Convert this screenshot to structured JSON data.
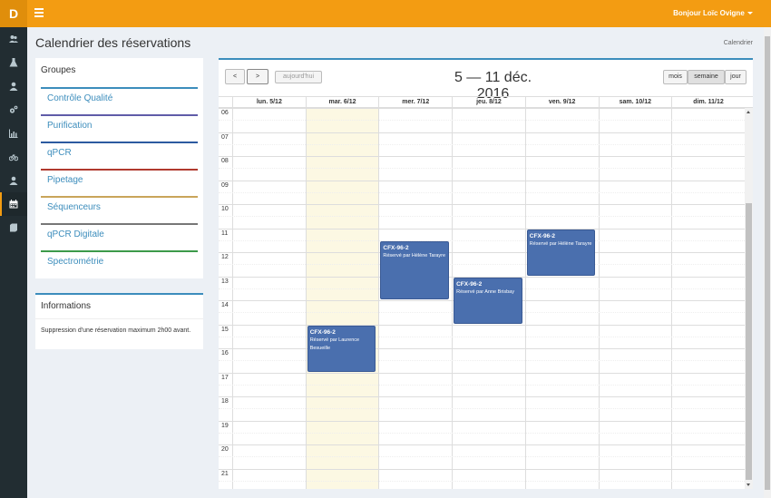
{
  "app": {
    "logo": "D"
  },
  "header": {
    "user_menu": "Bonjour Loïc Ovigne"
  },
  "sidebar": {
    "items": [
      {
        "name": "users-icon",
        "active": false
      },
      {
        "name": "flask-icon",
        "active": false
      },
      {
        "name": "user-icon",
        "active": false
      },
      {
        "name": "gears-icon",
        "active": false
      },
      {
        "name": "chart-icon",
        "active": false
      },
      {
        "name": "bicycle-icon",
        "active": false
      },
      {
        "name": "user-icon",
        "active": false
      },
      {
        "name": "calendar-icon",
        "active": true
      },
      {
        "name": "book-icon",
        "active": false
      }
    ]
  },
  "page": {
    "title": "Calendrier des réservations",
    "breadcrumb": "Calendrier"
  },
  "groups": {
    "title": "Groupes",
    "items": [
      {
        "label": "Contrôle Qualité",
        "color": "#3c8dbc"
      },
      {
        "label": "Purification",
        "color": "#605ca8"
      },
      {
        "label": "qPCR",
        "color": "#2c5aa0"
      },
      {
        "label": "Pipetage",
        "color": "#b03a2e"
      },
      {
        "label": "Séquenceurs",
        "color": "#c9a55a"
      },
      {
        "label": "qPCR Digitale",
        "color": "#777777"
      },
      {
        "label": "Spectrométrie",
        "color": "#3c9a4a"
      }
    ]
  },
  "info": {
    "title": "Informations",
    "text": "Suppression d'une réservation maximum 2h00 avant."
  },
  "calendar": {
    "prev_label": "<",
    "next_label": ">",
    "today_label": "aujourd'hui",
    "title": "5 — 11 déc. 2016",
    "views": [
      {
        "label": "mois",
        "active": false
      },
      {
        "label": "semaine",
        "active": true
      },
      {
        "label": "jour",
        "active": false
      }
    ],
    "days": [
      "lun. 5/12",
      "mar. 6/12",
      "mer. 7/12",
      "jeu. 8/12",
      "ven. 9/12",
      "sam. 10/12",
      "dim. 11/12"
    ],
    "today_index": 1,
    "hours": [
      "06",
      "07",
      "08",
      "09",
      "10",
      "11",
      "12",
      "13",
      "14",
      "15",
      "16",
      "17",
      "18",
      "19",
      "20",
      "21"
    ],
    "events": [
      {
        "day": 2,
        "start": 11.5,
        "end": 14.0,
        "time": "CFX-96-2",
        "text": "Réservé par Hélène Tarayre"
      },
      {
        "day": 3,
        "start": 13.0,
        "end": 15.0,
        "time": "CFX-96-2",
        "text": "Réservé par Anne Brisbay"
      },
      {
        "day": 4,
        "start": 11.0,
        "end": 13.0,
        "time": "CFX-96-2",
        "text": "Réservé par Hélène Tarayre"
      },
      {
        "day": 1,
        "start": 15.0,
        "end": 17.0,
        "time": "CFX-96-2",
        "text": "Réservé par Laurence Besueille"
      }
    ]
  }
}
